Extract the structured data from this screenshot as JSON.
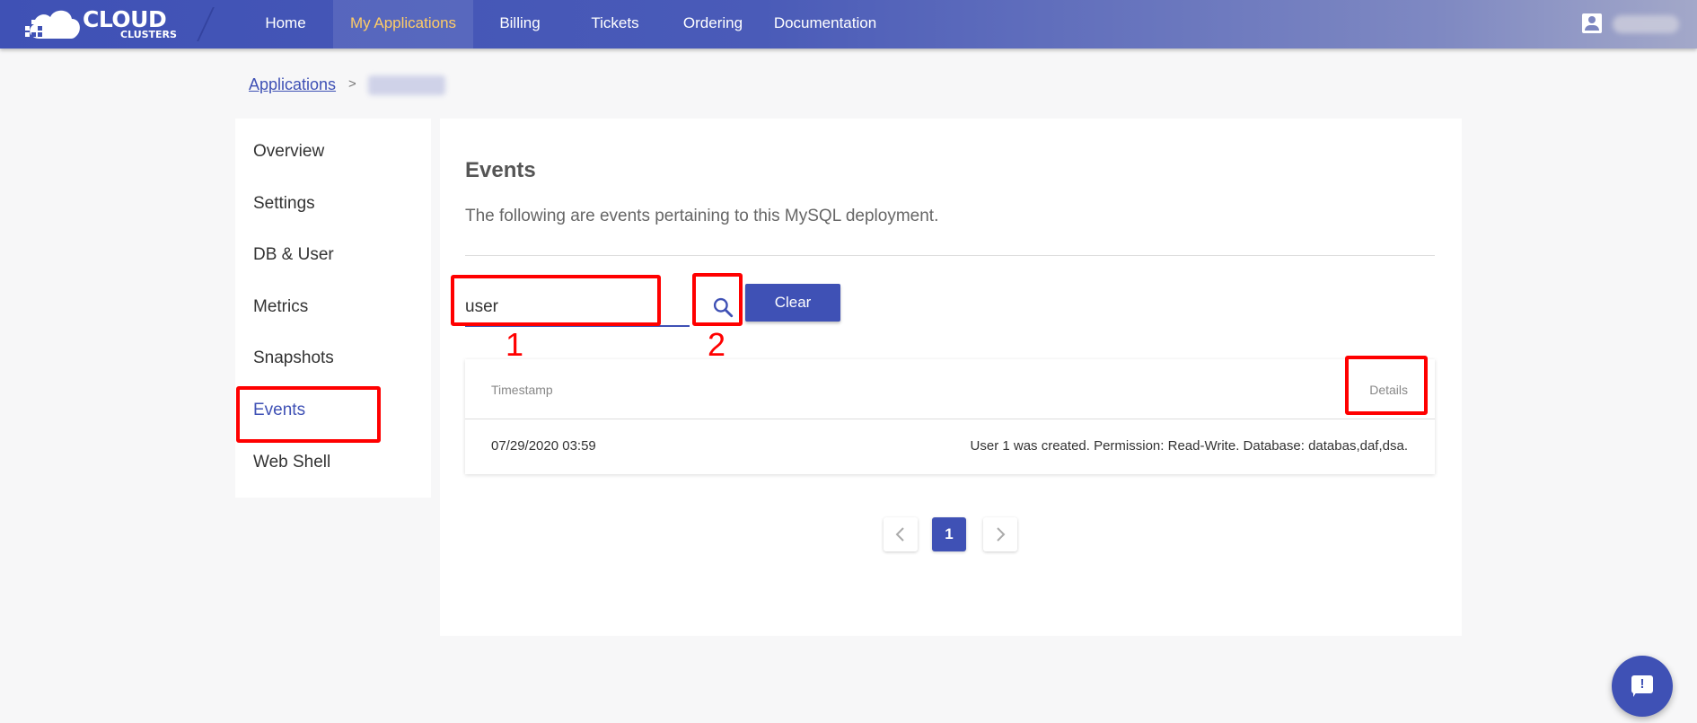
{
  "nav": {
    "logo_text": "CLOUD",
    "logo_subtext": "CLUSTERS",
    "items": [
      {
        "label": "Home"
      },
      {
        "label": "My Applications"
      },
      {
        "label": "Billing"
      },
      {
        "label": "Tickets"
      },
      {
        "label": "Ordering"
      },
      {
        "label": "Documentation"
      }
    ],
    "active_color": "#ffcc66",
    "primary_color": "#3f51b5",
    "user_icon": "account-box-icon"
  },
  "breadcrumb": {
    "root": "Applications",
    "separator": ">"
  },
  "sidebar": {
    "items": [
      {
        "label": "Overview"
      },
      {
        "label": "Settings"
      },
      {
        "label": "DB & User"
      },
      {
        "label": "Metrics"
      },
      {
        "label": "Snapshots"
      },
      {
        "label": "Events"
      },
      {
        "label": "Web Shell"
      }
    ],
    "active": "Events"
  },
  "main": {
    "title": "Events",
    "description": "The following are events pertaining to this MySQL deployment.",
    "search": {
      "value": "user",
      "icon": "search-icon"
    },
    "clear_label": "Clear",
    "table": {
      "columns": [
        "Timestamp",
        "Details"
      ],
      "rows": [
        {
          "timestamp": "07/29/2020 03:59",
          "details": "User 1 was created. Permission: Read-Write. Database: databas,daf,dsa."
        }
      ]
    },
    "pagination": {
      "prev_icon": "chevron-left-icon",
      "current": "1",
      "next_icon": "chevron-right-icon"
    }
  },
  "annotations": {
    "color": "#ff0000",
    "labels": [
      "1",
      "2"
    ]
  },
  "chat": {
    "icon": "chat-alert-icon"
  }
}
